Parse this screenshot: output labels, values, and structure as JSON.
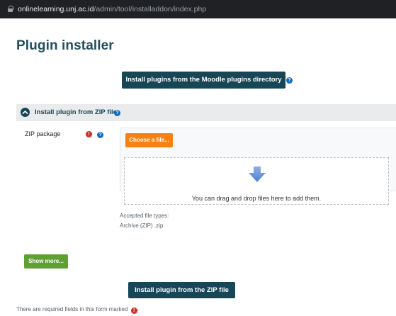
{
  "browser": {
    "url_host": "onlinelearning.unj.ac.id",
    "url_path": "/admin/tool/installaddon/index.php"
  },
  "page": {
    "title": "Plugin installer"
  },
  "actions": {
    "install_from_directory_label": "Install plugins from the Moodle plugins directory",
    "install_from_zip_label": "Install plugin from the ZIP file",
    "show_more_label": "Show more..."
  },
  "zip_section": {
    "title": "Install plugin from ZIP file",
    "field_label": "ZIP package",
    "required_icon": "!",
    "help_icon": "?",
    "choose_file_label": "Choose a file...",
    "drop_text": "You can drag and drop files here to add them.",
    "accepted_types_label": "Accepted file types:",
    "accepted_type_value": "Archive (ZIP) .zip"
  },
  "footer": {
    "required_note": "There are required fields in this form marked",
    "required_icon": "!"
  },
  "colors": {
    "primary": "#174656",
    "choose_button": "#f98012",
    "show_more_button": "#5fa033",
    "required": "#ca3120",
    "help": "#0f6cbf"
  }
}
